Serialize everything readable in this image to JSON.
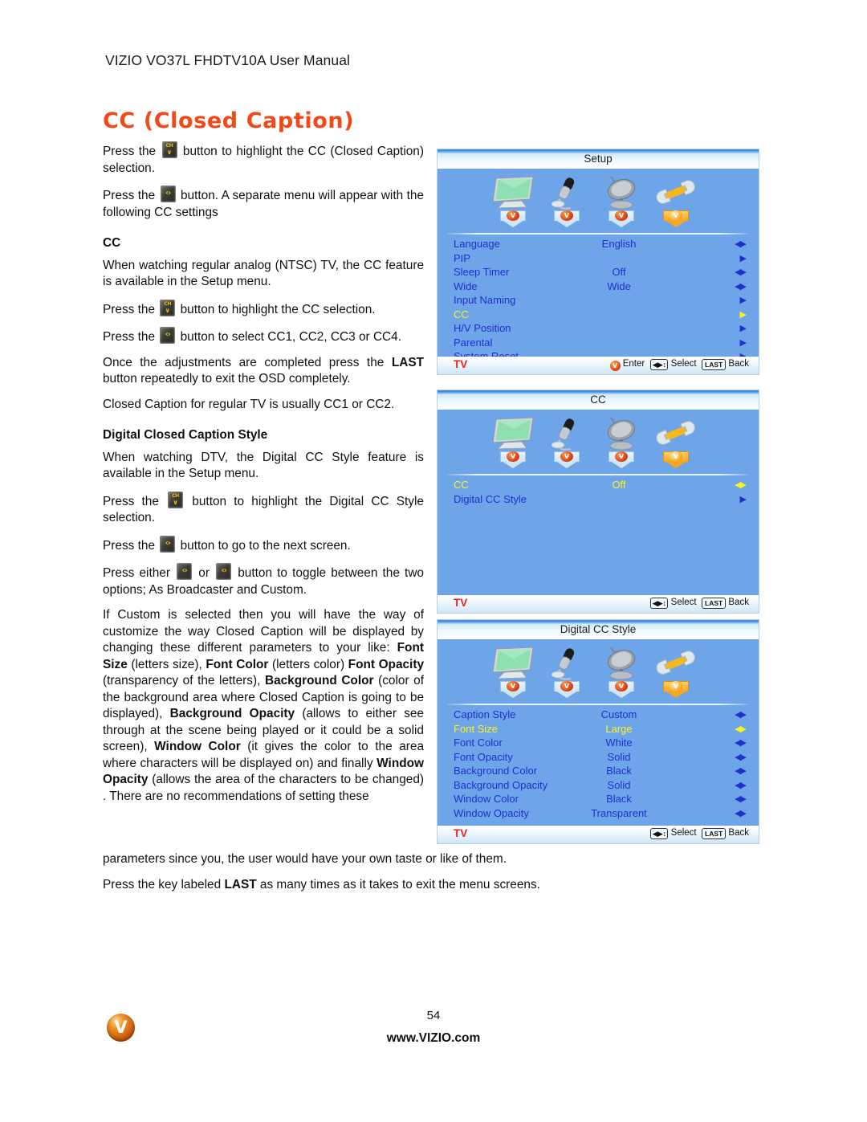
{
  "header": {
    "manual_title": "VIZIO VO37L FHDTV10A User Manual"
  },
  "page_title": "CC (Closed Caption)",
  "body": {
    "p1_a": "Press the",
    "p1_b": "button to highlight the CC (Closed Caption) selection.",
    "p2_a": "Press the",
    "p2_b": "button. A separate menu will appear with the following CC settings",
    "cc_heading": "CC",
    "p3": "When watching regular analog (NTSC) TV, the CC feature is available in the Setup menu.",
    "p4_a": "Press the",
    "p4_b": "button to highlight the CC selection.",
    "p5_a": "Press the",
    "p5_b": "button to select CC1, CC2, CC3 or CC4.",
    "p6_a": "Once the adjustments are completed press the",
    "p6_kw": "LAST",
    "p6_b": "button repeatedly to exit the OSD completely.",
    "p7": "Closed Caption for regular TV is usually CC1 or CC2.",
    "dcc_heading": "Digital Closed Caption Style",
    "p8": "When watching DTV, the Digital CC Style feature is available in the Setup menu.",
    "p9_a": "Press the",
    "p9_b": "button to highlight the Digital CC Style selection.",
    "p10_a": "Press the",
    "p10_b": "button to go to the next screen.",
    "p11_a": "Press either",
    "p11_mid": "or",
    "p11_b": "button to toggle between the two options; As Broadcaster and Custom.",
    "p12_s1": "If Custom is selected then you will have the way of customize the way Closed Caption will be displayed by changing these different parameters to your like:",
    "p12_kw1": "Font Size",
    "p12_s2": "(letters size),",
    "p12_kw2": "Font Color",
    "p12_s3": "(letters color)",
    "p12_kw3": "Font Opacity",
    "p12_s4": "(transparency of the letters),",
    "p12_kw4": "Background Color",
    "p12_s5": "(color of the background area where Closed Caption is going to be displayed),",
    "p12_kw5": "Background Opacity",
    "p12_s6": "(allows to either see through at the scene being played or it could be a solid screen),",
    "p12_kw6": "Window Color",
    "p12_s7": "(it gives the color to the area where characters will be displayed on) and finally",
    "p12_kw7": "Window Opacity",
    "p12_s8": "(allows the area of the characters to be changed) . There are no recommendations of setting these",
    "p13": "parameters since you, the user would have your own taste or like of them.",
    "p14_a": "Press the key labeled",
    "p14_kw": "LAST",
    "p14_b": "as many times as it takes to exit the menu screens."
  },
  "keys": {
    "ch_down": {
      "top": "CH",
      "bottom": "∨"
    },
    "vol_up": {
      "glyph": "‹›"
    },
    "vol_down": {
      "glyph": "‹›"
    }
  },
  "osd_common": {
    "icons": [
      {
        "name": "picture-monitor-icon",
        "glyph": "🖥",
        "active": false
      },
      {
        "name": "audio-microphone-icon",
        "glyph": "🎤",
        "active": false
      },
      {
        "name": "tuner-satellite-icon",
        "glyph": "📡",
        "active": false
      },
      {
        "name": "setup-wrench-icon",
        "glyph": "🔧",
        "active": true
      }
    ],
    "tab_letter": "V",
    "tv_label": "TV",
    "hint_enter": "Enter",
    "hint_select": "Select",
    "hint_back": "Back",
    "hint_last_key": "LAST",
    "hint_dpad": "◀▶↕",
    "hint_enter_letter": "V"
  },
  "osd_setup": {
    "title": "Setup",
    "rows": [
      {
        "label": "Language",
        "value": "English",
        "arrow": "both",
        "selected": false
      },
      {
        "label": "PIP",
        "value": "",
        "arrow": "right",
        "selected": false
      },
      {
        "label": "Sleep Timer",
        "value": "Off",
        "arrow": "both",
        "selected": false
      },
      {
        "label": "Wide",
        "value": "Wide",
        "arrow": "both",
        "selected": false
      },
      {
        "label": "Input Naming",
        "value": "",
        "arrow": "right",
        "selected": false
      },
      {
        "label": "CC",
        "value": "",
        "arrow": "right",
        "selected": true
      },
      {
        "label": "H/V Position",
        "value": "",
        "arrow": "right",
        "selected": false
      },
      {
        "label": "Parental",
        "value": "",
        "arrow": "right",
        "selected": false
      },
      {
        "label": "System Reset",
        "value": "",
        "arrow": "right",
        "selected": false
      }
    ],
    "has_enter_hint": true
  },
  "osd_cc": {
    "title": "CC",
    "rows": [
      {
        "label": "CC",
        "value": "Off",
        "arrow": "both",
        "selected": true
      },
      {
        "label": "Digital CC Style",
        "value": "",
        "arrow": "right",
        "selected": false
      }
    ],
    "has_enter_hint": false
  },
  "osd_digital_cc_style": {
    "title": "Digital CC Style",
    "rows": [
      {
        "label": "Caption Style",
        "value": "Custom",
        "arrow": "both",
        "selected": false
      },
      {
        "label": "Font Size",
        "value": "Large",
        "arrow": "both",
        "selected": true
      },
      {
        "label": "Font Color",
        "value": "White",
        "arrow": "both",
        "selected": false
      },
      {
        "label": "Font Opacity",
        "value": "Solid",
        "arrow": "both",
        "selected": false
      },
      {
        "label": "Background Color",
        "value": "Black",
        "arrow": "both",
        "selected": false
      },
      {
        "label": "Background Opacity",
        "value": "Solid",
        "arrow": "both",
        "selected": false
      },
      {
        "label": "Window Color",
        "value": "Black",
        "arrow": "both",
        "selected": false
      },
      {
        "label": "Window Opacity",
        "value": "Transparent",
        "arrow": "both",
        "selected": false
      }
    ],
    "has_enter_hint": false
  },
  "footer": {
    "page_number": "54",
    "url": "www.VIZIO.com",
    "logo_letter": "V"
  },
  "colors": {
    "title_orange": "#f04a18",
    "osd_background": "#6ea5e8",
    "osd_label_blue": "#1f2fd0",
    "osd_selected_yellow": "#ffef26",
    "osd_tv_red": "#e8251b",
    "key_glyph_yellow": "#f5b60c"
  }
}
